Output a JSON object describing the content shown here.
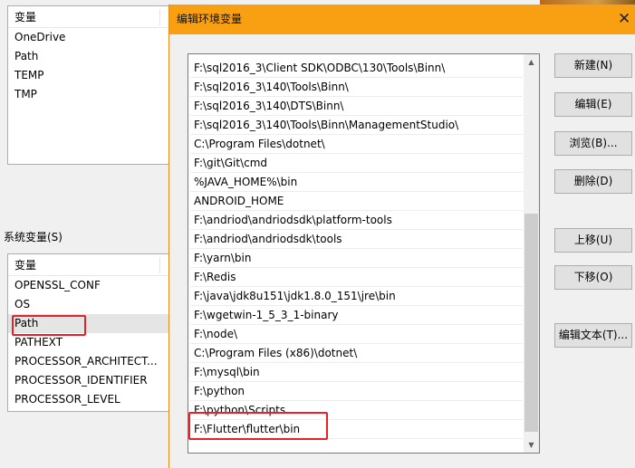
{
  "parent": {
    "user_vars": {
      "header": "变量",
      "items": [
        "OneDrive",
        "Path",
        "TEMP",
        "TMP"
      ]
    },
    "system_vars_label": "系统变量(S)",
    "system_vars": {
      "header": "变量",
      "items": [
        "OPENSSL_CONF",
        "OS",
        "Path",
        "PATHEXT",
        "PROCESSOR_ARCHITECT...",
        "PROCESSOR_IDENTIFIER",
        "PROCESSOR_LEVEL"
      ],
      "selected": "Path"
    }
  },
  "dialog": {
    "title": "编辑环境变量",
    "close_glyph": "✕",
    "paths": [
      "F:\\sql2016_3\\Client SDK\\ODBC\\130\\Tools\\Binn\\",
      "F:\\sql2016_3\\140\\Tools\\Binn\\",
      "F:\\sql2016_3\\140\\DTS\\Binn\\",
      "F:\\sql2016_3\\140\\Tools\\Binn\\ManagementStudio\\",
      "C:\\Program Files\\dotnet\\",
      "F:\\git\\Git\\cmd",
      "%JAVA_HOME%\\bin",
      "ANDROID_HOME",
      "F:\\andriod\\andriodsdk\\platform-tools",
      "F:\\andriod\\andriodsdk\\tools",
      "F:\\yarn\\bin",
      "F:\\Redis",
      "F:\\java\\jdk8u151\\jdk1.8.0_151\\jre\\bin",
      "F:\\wgetwin-1_5_3_1-binary",
      "F:\\node\\",
      "C:\\Program Files (x86)\\dotnet\\",
      "F:\\mysql\\bin",
      "F:\\python",
      "F:\\python\\Scripts",
      "F:\\Flutter\\flutter\\bin"
    ],
    "highlighted_path": "F:\\Flutter\\flutter\\bin",
    "buttons": {
      "new": "新建(N)",
      "edit": "编辑(E)",
      "browse": "浏览(B)...",
      "delete": "删除(D)",
      "move_up": "上移(U)",
      "move_down": "下移(O)",
      "edit_text": "编辑文本(T)..."
    }
  },
  "colors": {
    "title_bar": "#f9a012",
    "highlight_box": "#e8202a"
  }
}
